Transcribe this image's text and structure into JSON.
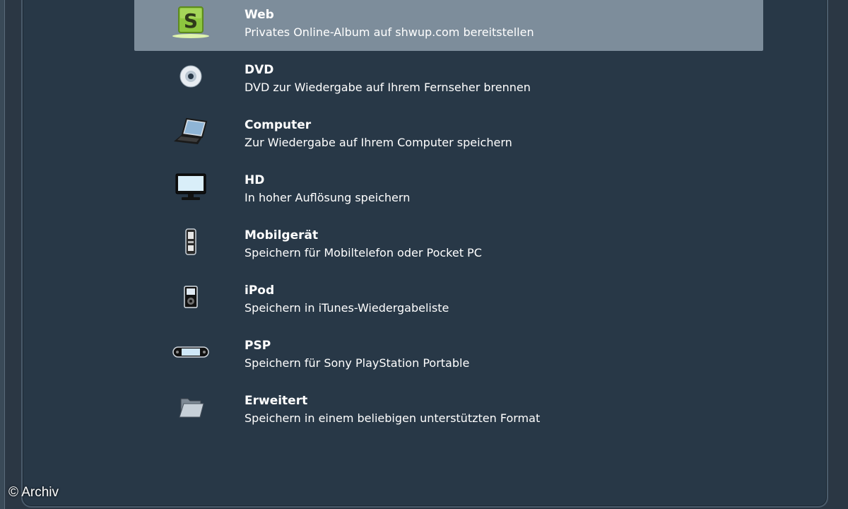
{
  "items": [
    {
      "title": "Web",
      "desc": "Privates Online-Album auf shwup.com bereitstellen",
      "icon": "shwup-logo-icon",
      "selected": true
    },
    {
      "title": "DVD",
      "desc": "DVD zur Wiedergabe auf Ihrem Fernseher brennen",
      "icon": "dvd-disc-icon"
    },
    {
      "title": "Computer",
      "desc": "Zur Wiedergabe auf Ihrem Computer speichern",
      "icon": "laptop-icon"
    },
    {
      "title": "HD",
      "desc": "In hoher Auflösung speichern",
      "icon": "hd-monitor-icon"
    },
    {
      "title": "Mobilgerät",
      "desc": "Speichern für Mobiltelefon oder Pocket PC",
      "icon": "mobile-phone-icon"
    },
    {
      "title": "iPod",
      "desc": "Speichern in iTunes-Wiedergabeliste",
      "icon": "ipod-icon"
    },
    {
      "title": "PSP",
      "desc": "Speichern für Sony PlayStation Portable",
      "icon": "psp-icon"
    },
    {
      "title": "Erweitert",
      "desc": "Speichern in einem beliebigen unterstützten Format",
      "icon": "folder-icon"
    }
  ],
  "logo_letter": "S",
  "watermark": "© Archiv",
  "colors": {
    "background": "#283847",
    "selected": "#7d8d9b",
    "logo_green": "#8dc63f"
  }
}
